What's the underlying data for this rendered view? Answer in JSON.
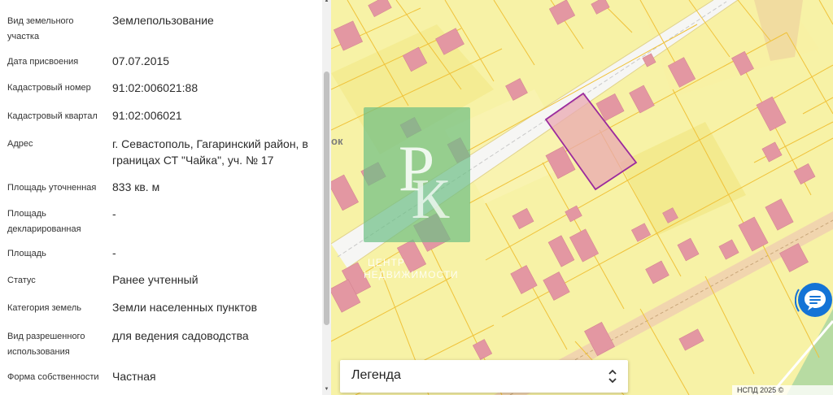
{
  "info_panel": {
    "rows": [
      {
        "label": "Вид земельного участка",
        "value": "Землепользование"
      },
      {
        "label": "Дата присвоения",
        "value": "07.07.2015"
      },
      {
        "label": "Кадастровый номер",
        "value": "91:02:006021:88"
      },
      {
        "label": "Кадастровый квартал",
        "value": "91:02:006021"
      },
      {
        "label": "Адрес",
        "value": "г. Севастополь, Гагаринский район, в границах СТ \"Чайка\", уч. № 17"
      },
      {
        "label": "Площадь уточненная",
        "value": "833 кв. м"
      },
      {
        "label": "Площадь декларированная",
        "value": "-"
      },
      {
        "label": "Площадь",
        "value": "-"
      },
      {
        "label": "Статус",
        "value": "Ранее учтенный"
      },
      {
        "label": "Категория земель",
        "value": "Земли населенных пунктов"
      },
      {
        "label": "Вид разрешенного использования",
        "value": "для ведения садоводства"
      },
      {
        "label": "Форма собственности",
        "value": "Частная"
      }
    ]
  },
  "map": {
    "street_label_fragment": "ок",
    "watermark": {
      "line1": "ЦЕНТР",
      "line2": "НЕДВИЖИМОСТИ"
    },
    "legend": {
      "label": "Легенда"
    },
    "copyright": "НСПД 2025 ©",
    "colors": {
      "background": "#f7f2a6",
      "parcel_border": "#f0c23a",
      "building": "#e397a2",
      "selected_outline": "#9b2a9d",
      "road": "#f6f6f4",
      "watermark": "#6cbf84",
      "chat_button": "#1473d6"
    },
    "icons": [
      "chat-icon",
      "updown-chevron-icon",
      "scroll-up-arrow-icon",
      "scroll-down-arrow-icon"
    ]
  }
}
